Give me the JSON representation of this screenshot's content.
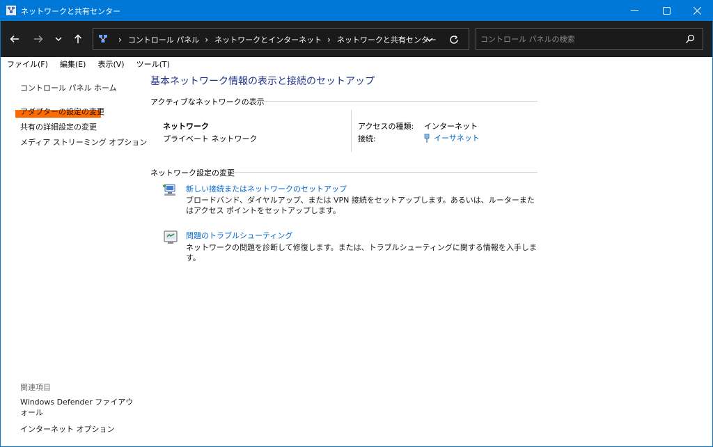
{
  "window": {
    "title": "ネットワークと共有センター"
  },
  "addressbar": {
    "crumbs": [
      "コントロール パネル",
      "ネットワークとインターネット",
      "ネットワークと共有センター"
    ],
    "search_placeholder": "コントロール パネルの検索"
  },
  "menu": [
    "ファイル(F)",
    "編集(E)",
    "表示(V)",
    "ツール(T)"
  ],
  "sidebar": {
    "home": "コントロール パネル ホーム",
    "adapter": "アダプターの設定の変更",
    "sharing": "共有の詳細設定の変更",
    "media": "メディア ストリーミング オプション",
    "related_heading": "関連項目",
    "defender": "Windows Defender ファイアウォール",
    "internet_options": "インターネット オプション"
  },
  "main": {
    "title": "基本ネットワーク情報の表示と接続のセットアップ",
    "active_heading": "アクティブなネットワークの表示",
    "network_name": "ネットワーク",
    "network_type": "プライベート ネットワーク",
    "access_label": "アクセスの種類:",
    "access_value": "インターネット",
    "connection_label": "接続:",
    "connection_value": "イーサネット",
    "change_heading": "ネットワーク設定の変更",
    "tasks": [
      {
        "link": "新しい接続またはネットワークのセットアップ",
        "desc": "ブロードバンド、ダイヤルアップ、または VPN 接続をセットアップします。あるいは、ルーターまたはアクセス ポイントをセットアップします。"
      },
      {
        "link": "問題のトラブルシューティング",
        "desc": "ネットワークの問題を診断して修復します。または、トラブルシューティングに関する情報を入手します。"
      }
    ]
  },
  "colors": {
    "titlebar": "#0078d7",
    "addressbar": "#1f1f1f",
    "link": "#0066cc",
    "heading": "#1e3287",
    "highlight": "#ff6a00"
  }
}
